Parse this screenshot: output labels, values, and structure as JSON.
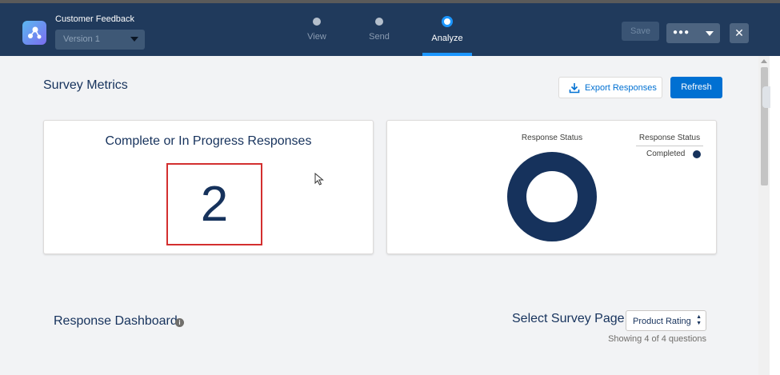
{
  "header": {
    "app_title": "Customer Feedback",
    "version": "Version 1",
    "steps": [
      {
        "label": "View",
        "active": false
      },
      {
        "label": "Send",
        "active": false
      },
      {
        "label": "Analyze",
        "active": true
      }
    ],
    "save_label": "Save",
    "more_label": "●●●",
    "close_label": "✕"
  },
  "metrics": {
    "title": "Survey Metrics",
    "export_label": "Export Responses",
    "refresh_label": "Refresh",
    "card_title": "Complete or In Progress Responses",
    "card_value": "2"
  },
  "chart_data": {
    "type": "pie",
    "title": "Response Status",
    "legend_title": "Response Status",
    "categories": [
      "Completed"
    ],
    "values": [
      2
    ],
    "colors": [
      "#16325c"
    ],
    "legend_position": "right"
  },
  "dashboard": {
    "title": "Response Dashboard",
    "info_icon": "i",
    "select_label": "Select Survey Page",
    "selected_page": "Product Rating",
    "showing": "Showing 4 of 4 questions"
  },
  "colors": {
    "header_bg": "#203a5c",
    "brand_blue": "#0070d2",
    "accent_bar": "#1b96ff",
    "highlight_border": "#d32f2f",
    "donut": "#16325c"
  }
}
